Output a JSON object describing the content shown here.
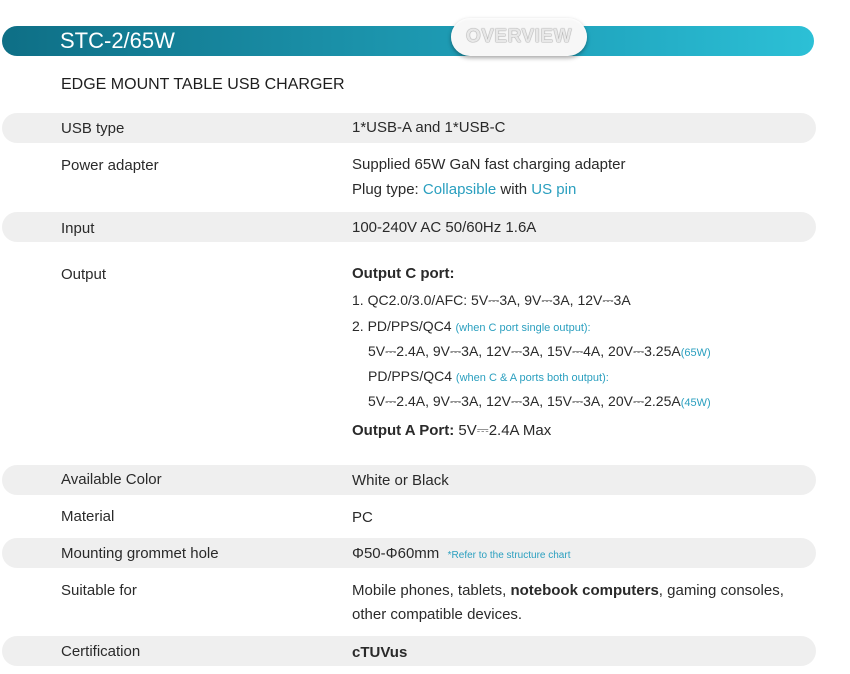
{
  "header": {
    "model": "STC-2/65W",
    "overview_tab": "OVERVIEW"
  },
  "subtitle": "EDGE MOUNT TABLE USB CHARGER",
  "specs": {
    "usb_type": {
      "label": "USB type",
      "value": "1*USB-A and 1*USB-C"
    },
    "power_adapter": {
      "label": "Power adapter",
      "line1": "Supplied 65W GaN fast charging adapter",
      "plug_prefix": "Plug type: ",
      "plug_collapsible": "Collapsible",
      "plug_with": " with ",
      "plug_pin": "US pin"
    },
    "input": {
      "label": "Input",
      "value": "100-240V AC 50/60Hz 1.6A"
    },
    "output": {
      "label": "Output",
      "c_port_heading": "Output C port:",
      "line1": "1. QC2.0/3.0/AFC: 5V⎓3A, 9V⎓3A, 12V⎓3A",
      "line2_main": "2. PD/PPS/QC4 ",
      "line2_note": "(when C port single output):",
      "line3_main": "5V⎓2.4A, 9V⎓3A, 12V⎓3A, 15V⎓4A, 20V⎓3.25A",
      "line3_note": "(65W)",
      "line4_main": "PD/PPS/QC4 ",
      "line4_note": "(when C & A ports both output):",
      "line5_main": "5V⎓2.4A, 9V⎓3A, 12V⎓3A, 15V⎓3A, 20V⎓2.25A",
      "line5_note": "(45W)",
      "a_port_heading": "Output A Port:",
      "a_port_value": " 5V⎓2.4A Max"
    },
    "color": {
      "label": "Available Color",
      "value": "White or Black"
    },
    "material": {
      "label": "Material",
      "value": "PC"
    },
    "grommet": {
      "label": "Mounting grommet hole",
      "value": "Φ50-Φ60mm",
      "note": "*Refer to the structure chart"
    },
    "suitable": {
      "label": "Suitable for",
      "part1": "Mobile phones, tablets, ",
      "bold": "notebook computers",
      "part2": ", gaming consoles,",
      "line2": "other compatible devices."
    },
    "certification": {
      "label": "Certification",
      "value": "cTUVus"
    }
  },
  "colors": {
    "accent": "#1a8fa7",
    "link_teal": "#2a9fbf",
    "row_stripe": "#efefef"
  }
}
